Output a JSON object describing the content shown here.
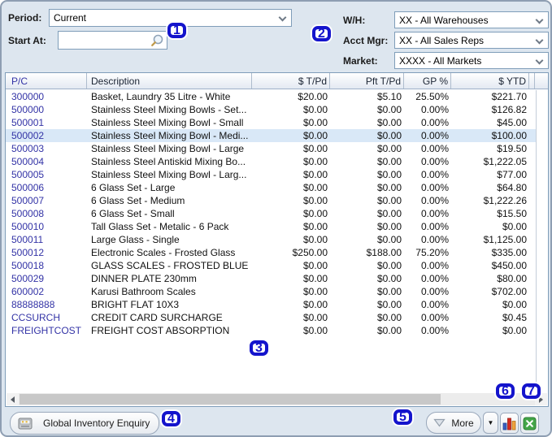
{
  "filters": {
    "period_label": "Period:",
    "period_value": "Current",
    "start_at_label": "Start At:",
    "start_at_value": "",
    "wh_label": "W/H:",
    "wh_value": "XX - All Warehouses",
    "acct_mgr_label": "Acct Mgr:",
    "acct_mgr_value": "XX - All Sales Reps",
    "market_label": "Market:",
    "market_value": "XXXX - All Markets"
  },
  "table": {
    "columns": {
      "pc": "P/C",
      "desc": "Description",
      "tpd": "$ T/Pd",
      "pft": "Pft T/Pd",
      "gp": "GP %",
      "ytd": "$ YTD"
    },
    "rows": [
      {
        "pc": "300000",
        "desc": "Basket, Laundry 35 Litre - White",
        "tpd": "$20.00",
        "pft": "$5.10",
        "gp": "25.50%",
        "ytd": "$221.70"
      },
      {
        "pc": "500000",
        "desc": "Stainless Steel Mixing Bowls - Set...",
        "tpd": "$0.00",
        "pft": "$0.00",
        "gp": "0.00%",
        "ytd": "$126.82"
      },
      {
        "pc": "500001",
        "desc": "Stainless Steel Mixing Bowl - Small",
        "tpd": "$0.00",
        "pft": "$0.00",
        "gp": "0.00%",
        "ytd": "$45.00"
      },
      {
        "pc": "500002",
        "desc": "Stainless Steel Mixing Bowl - Medi...",
        "tpd": "$0.00",
        "pft": "$0.00",
        "gp": "0.00%",
        "ytd": "$100.00",
        "selected": true
      },
      {
        "pc": "500003",
        "desc": "Stainless Steel Mixing Bowl - Large",
        "tpd": "$0.00",
        "pft": "$0.00",
        "gp": "0.00%",
        "ytd": "$19.50"
      },
      {
        "pc": "500004",
        "desc": "Stainless Steel Antiskid Mixing Bo...",
        "tpd": "$0.00",
        "pft": "$0.00",
        "gp": "0.00%",
        "ytd": "$1,222.05"
      },
      {
        "pc": "500005",
        "desc": "Stainless Steel Mixing Bowl - Larg...",
        "tpd": "$0.00",
        "pft": "$0.00",
        "gp": "0.00%",
        "ytd": "$77.00"
      },
      {
        "pc": "500006",
        "desc": "6 Glass Set - Large",
        "tpd": "$0.00",
        "pft": "$0.00",
        "gp": "0.00%",
        "ytd": "$64.80"
      },
      {
        "pc": "500007",
        "desc": "6 Glass Set - Medium",
        "tpd": "$0.00",
        "pft": "$0.00",
        "gp": "0.00%",
        "ytd": "$1,222.26"
      },
      {
        "pc": "500008",
        "desc": "6 Glass Set - Small",
        "tpd": "$0.00",
        "pft": "$0.00",
        "gp": "0.00%",
        "ytd": "$15.50"
      },
      {
        "pc": "500010",
        "desc": "Tall Glass Set - Metalic - 6 Pack",
        "tpd": "$0.00",
        "pft": "$0.00",
        "gp": "0.00%",
        "ytd": "$0.00"
      },
      {
        "pc": "500011",
        "desc": "Large Glass - Single",
        "tpd": "$0.00",
        "pft": "$0.00",
        "gp": "0.00%",
        "ytd": "$1,125.00"
      },
      {
        "pc": "500012",
        "desc": "Electronic Scales - Frosted Glass",
        "tpd": "$250.00",
        "pft": "$188.00",
        "gp": "75.20%",
        "ytd": "$335.00"
      },
      {
        "pc": "500018",
        "desc": "GLASS SCALES - FROSTED BLUE",
        "tpd": "$0.00",
        "pft": "$0.00",
        "gp": "0.00%",
        "ytd": "$450.00"
      },
      {
        "pc": "500029",
        "desc": "DINNER PLATE 230mm",
        "tpd": "$0.00",
        "pft": "$0.00",
        "gp": "0.00%",
        "ytd": "$80.00"
      },
      {
        "pc": "600002",
        "desc": "Karusi Bathroom Scales",
        "tpd": "$0.00",
        "pft": "$0.00",
        "gp": "0.00%",
        "ytd": "$702.00"
      },
      {
        "pc": "88888888",
        "desc": "BRIGHT FLAT 10X3",
        "tpd": "$0.00",
        "pft": "$0.00",
        "gp": "0.00%",
        "ytd": "$0.00"
      },
      {
        "pc": "CCSURCH",
        "desc": "CREDIT CARD SURCHARGE",
        "tpd": "$0.00",
        "pft": "$0.00",
        "gp": "0.00%",
        "ytd": "$0.45"
      },
      {
        "pc": "FREIGHTCOST",
        "desc": "FREIGHT COST ABSORPTION",
        "tpd": "$0.00",
        "pft": "$0.00",
        "gp": "0.00%",
        "ytd": "$0.00"
      }
    ]
  },
  "footer": {
    "global_button": "Global Inventory Enquiry",
    "more_button": "More",
    "more_dropdown_glyph": "▼"
  },
  "annotations": [
    "1",
    "2",
    "3",
    "4",
    "5",
    "6",
    "7"
  ],
  "icons": {
    "search": "magnifier-icon",
    "chart": "bar-chart-icon",
    "excel": "excel-export-icon",
    "enquiry": "enquiry-window-icon"
  },
  "colors": {
    "annotation_blue": "#1414cc",
    "product_code_link": "#3333a6",
    "selected_row_bg": "#d9e8f7",
    "panel_bg": "#dde6ef",
    "excel_green": "#44a648",
    "chart_bar_blue": "#3b5fc0",
    "chart_bar_red": "#d42a20",
    "chart_bar_orange": "#f0a23c"
  }
}
